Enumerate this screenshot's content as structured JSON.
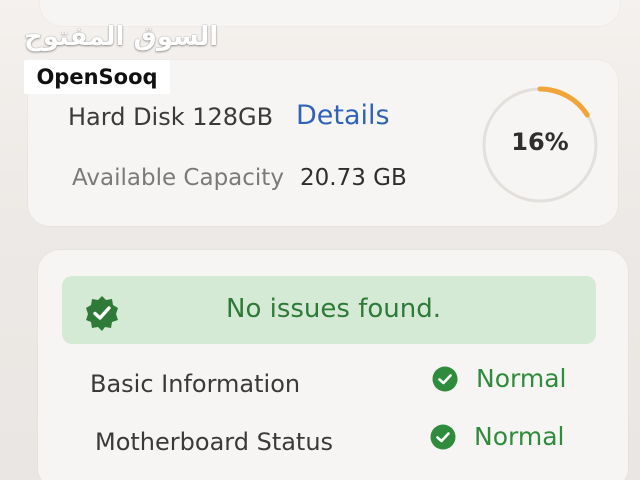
{
  "watermark": {
    "arabic": "السوق المفتوح",
    "brand": "OpenSooq"
  },
  "disk": {
    "name": "Hard Disk 128GB",
    "details_label": "Details",
    "capacity_label": "Available Capacity",
    "capacity_value": "20.73 GB",
    "usage_text": "16%",
    "usage_fraction": 0.16
  },
  "health": {
    "status_text": "No issues found.",
    "rows": [
      {
        "label": "Basic Information",
        "value": "Normal"
      },
      {
        "label": "Motherboard Status",
        "value": "Normal"
      }
    ]
  },
  "colors": {
    "accent_link": "#2f63b8",
    "ring_progress": "#f0a43a",
    "ring_track": "#e2dfdc",
    "ok_green": "#2f8c3c",
    "banner_bg": "#d5ead5"
  },
  "icons": {
    "status": "verified-badge-icon",
    "row": "check-circle-icon"
  }
}
